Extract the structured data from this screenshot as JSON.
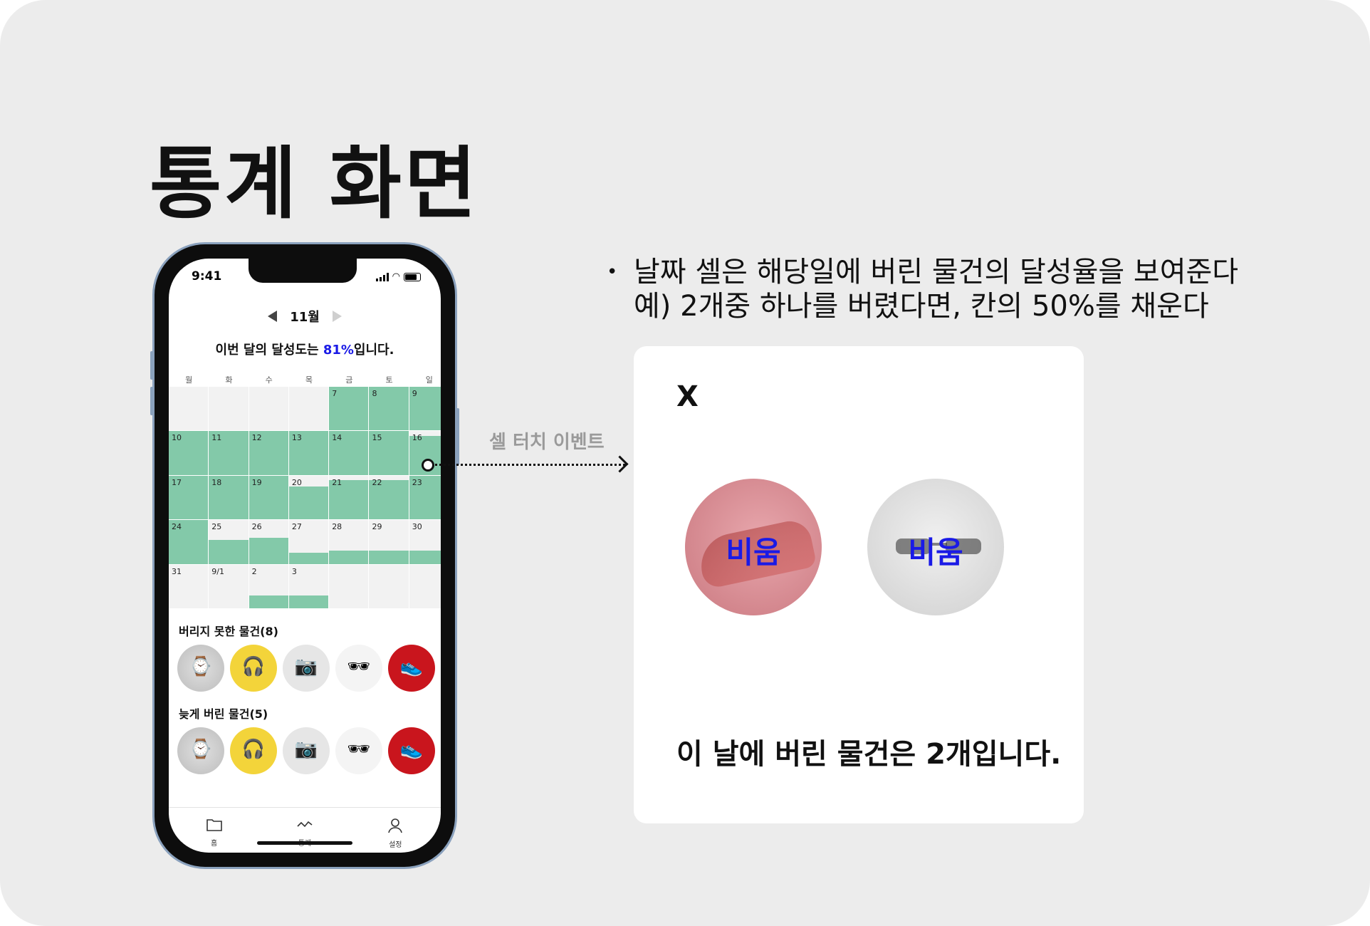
{
  "page": {
    "title": "통계 화면"
  },
  "phone": {
    "status_time": "9:41",
    "month": "11월",
    "achievement": {
      "prefix": "이번 달의 달성도는 ",
      "percent": "81%",
      "suffix": "입니다."
    },
    "weekdays": [
      "월",
      "화",
      "수",
      "목",
      "금",
      "토",
      "일"
    ],
    "calendar": [
      {
        "label": "",
        "fill": 0
      },
      {
        "label": "",
        "fill": 0
      },
      {
        "label": "",
        "fill": 0
      },
      {
        "label": "",
        "fill": 0
      },
      {
        "label": "7",
        "fill": 1
      },
      {
        "label": "8",
        "fill": 1
      },
      {
        "label": "9",
        "fill": 1
      },
      {
        "label": "10",
        "fill": 1
      },
      {
        "label": "11",
        "fill": 1
      },
      {
        "label": "12",
        "fill": 1
      },
      {
        "label": "13",
        "fill": 1
      },
      {
        "label": "14",
        "fill": 1
      },
      {
        "label": "15",
        "fill": 1
      },
      {
        "label": "16",
        "fill": 0.9
      },
      {
        "label": "17",
        "fill": 1
      },
      {
        "label": "18",
        "fill": 1
      },
      {
        "label": "19",
        "fill": 1
      },
      {
        "label": "20",
        "fill": 0.75
      },
      {
        "label": "21",
        "fill": 0.9
      },
      {
        "label": "22",
        "fill": 0.9
      },
      {
        "label": "23",
        "fill": 1
      },
      {
        "label": "24",
        "fill": 1
      },
      {
        "label": "25",
        "fill": 0.55
      },
      {
        "label": "26",
        "fill": 0.6
      },
      {
        "label": "27",
        "fill": 0.25
      },
      {
        "label": "28",
        "fill": 0.3
      },
      {
        "label": "29",
        "fill": 0.3
      },
      {
        "label": "30",
        "fill": 0.3
      },
      {
        "label": "31",
        "fill": 0
      },
      {
        "label": "9/1",
        "fill": 0
      },
      {
        "label": "2",
        "fill": 0.3
      },
      {
        "label": "3",
        "fill": 0.3
      },
      {
        "label": "",
        "fill": 0
      },
      {
        "label": "",
        "fill": 0
      },
      {
        "label": "",
        "fill": 0
      }
    ],
    "not_discarded": {
      "label": "버리지 못한 물건(8)",
      "items": [
        "watch",
        "headphones",
        "camera",
        "sunglasses",
        "sneaker"
      ]
    },
    "late_discarded": {
      "label": "늦게 버린 물건(5)",
      "items": [
        "watch",
        "headphones",
        "camera",
        "sunglasses",
        "sneaker"
      ]
    },
    "tabs": [
      {
        "label": "홈",
        "icon": "folder-icon"
      },
      {
        "label": "통계",
        "icon": "chart-icon"
      },
      {
        "label": "설정",
        "icon": "user-icon"
      }
    ]
  },
  "annotation": {
    "line1": "날짜 셀은 해당일에 버린 물건의 달성율을 보여준다",
    "line2": "예) 2개중 하나를 버렸다면, 칸의 50%를 채운다",
    "event_label": "셀 터치 이벤트"
  },
  "popup": {
    "close": "X",
    "items": [
      {
        "name": "sneaker",
        "overlay": "비움"
      },
      {
        "name": "sunglasses",
        "overlay": "비움"
      }
    ],
    "message": "이 날에 버린 물건은 2개입니다."
  },
  "colors": {
    "fill": "#83c9a9",
    "accent": "#1a1ae6",
    "board": "#ececec"
  }
}
